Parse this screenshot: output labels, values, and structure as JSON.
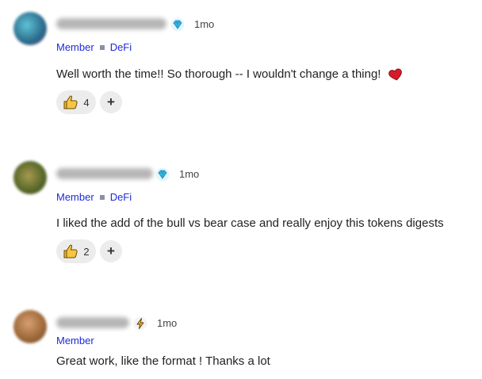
{
  "comments": [
    {
      "author_name": "Kim (Jaedde) Louie",
      "badge_icon": "diamond-icon",
      "time": "1mo",
      "role": "Member",
      "group": "DeFi",
      "text": "Well worth the time!! So thorough -- I wouldn't change a thing!",
      "trailing_emoji": "heart-icon",
      "reaction_icon": "thumbs-up-icon",
      "reaction_count": "4",
      "add_reaction_label": "+",
      "avatar_color": "#3a8fa8"
    },
    {
      "author_name": "plantinshadow",
      "badge_icon": "diamond-icon",
      "time": "1mo",
      "role": "Member",
      "group": "DeFi",
      "text": "I liked the add of the bull vs bear case and really enjoy this tokens digests",
      "reaction_icon": "thumbs-up-icon",
      "reaction_count": "2",
      "add_reaction_label": "+",
      "avatar_color": "#6c7a3a"
    },
    {
      "author_name": "Emil Sparge",
      "badge_icon": "lightning-icon",
      "time": "1mo",
      "role": "Member",
      "text": "Great work, like the format ! Thanks a lot",
      "avatar_color": "#b07a4a"
    }
  ],
  "colors": {
    "member_link": "#1f2bd6",
    "pill_bg": "#ececec",
    "diamond": "#35b6e0",
    "lightning": "#e8a020"
  }
}
